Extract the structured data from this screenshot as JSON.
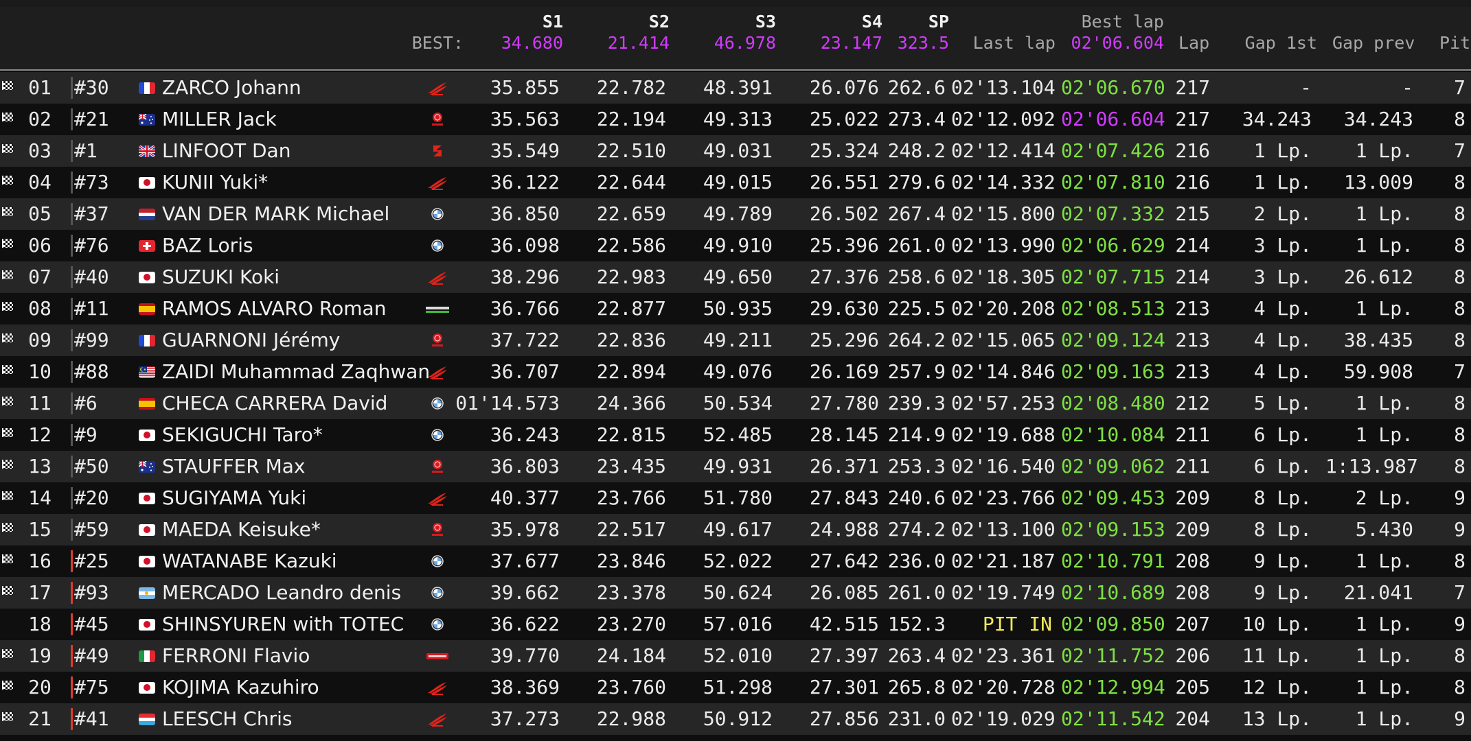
{
  "header": {
    "best_label": "BEST:",
    "s1": {
      "label": "S1",
      "best": "34.680"
    },
    "s2": {
      "label": "S2",
      "best": "21.414"
    },
    "s3": {
      "label": "S3",
      "best": "46.978"
    },
    "s4": {
      "label": "S4",
      "best": "23.147"
    },
    "sp": {
      "label": "SP",
      "best": "323.5"
    },
    "last_lap_label": "Last lap",
    "best_lap": {
      "label": "Best lap",
      "best": "02'06.604"
    },
    "lap_label": "Lap",
    "gap1_label": "Gap 1st",
    "gapprev_label": "Gap prev",
    "pit_label": "Pit"
  },
  "colors": {
    "purple": "#d13bff",
    "green": "#7fe043",
    "yellow": "#f2e85a",
    "red_marker": "#e1392f"
  },
  "rows": [
    {
      "pos": "01",
      "num": "#30",
      "flag": "fr",
      "name": "ZARCO Johann",
      "brand": "honda",
      "s1": "35.855",
      "s2": "22.782",
      "s3": "48.391",
      "s4": "26.076",
      "sp": "262.6",
      "last": "02'13.104",
      "best": "02'06.670",
      "best_color": "green",
      "lap": "217",
      "gap1": "-",
      "gapprev": "-",
      "pit": "7",
      "flagged": true,
      "red": false
    },
    {
      "pos": "02",
      "num": "#21",
      "flag": "au",
      "name": "MILLER Jack",
      "brand": "yamaha",
      "s1": "35.563",
      "s2": "22.194",
      "s3": "49.313",
      "s4": "25.022",
      "sp": "273.4",
      "last": "02'12.092",
      "best": "02'06.604",
      "best_color": "purple",
      "lap": "217",
      "gap1": "34.243",
      "gapprev": "34.243",
      "pit": "8",
      "flagged": true,
      "red": false
    },
    {
      "pos": "03",
      "num": "#1",
      "flag": "gb",
      "name": "LINFOOT Dan",
      "brand": "suzuki",
      "s1": "35.549",
      "s2": "22.510",
      "s3": "49.031",
      "s4": "25.324",
      "sp": "248.2",
      "last": "02'12.414",
      "best": "02'07.426",
      "best_color": "green",
      "lap": "216",
      "gap1": "1 Lp.",
      "gapprev": "1 Lp.",
      "pit": "7",
      "flagged": true,
      "red": false
    },
    {
      "pos": "04",
      "num": "#73",
      "flag": "jp",
      "name": "KUNII Yuki*",
      "brand": "honda",
      "s1": "36.122",
      "s2": "22.644",
      "s3": "49.015",
      "s4": "26.551",
      "sp": "279.6",
      "last": "02'14.332",
      "best": "02'07.810",
      "best_color": "green",
      "lap": "216",
      "gap1": "1 Lp.",
      "gapprev": "13.009",
      "pit": "8",
      "flagged": true,
      "red": false
    },
    {
      "pos": "05",
      "num": "#37",
      "flag": "nl",
      "name": "VAN DER MARK Michael",
      "brand": "bmw",
      "s1": "36.850",
      "s2": "22.659",
      "s3": "49.789",
      "s4": "26.502",
      "sp": "267.4",
      "last": "02'15.800",
      "best": "02'07.332",
      "best_color": "green",
      "lap": "215",
      "gap1": "2 Lp.",
      "gapprev": "1 Lp.",
      "pit": "8",
      "flagged": true,
      "red": false
    },
    {
      "pos": "06",
      "num": "#76",
      "flag": "ch",
      "name": "BAZ Loris",
      "brand": "bmw",
      "s1": "36.098",
      "s2": "22.586",
      "s3": "49.910",
      "s4": "25.396",
      "sp": "261.0",
      "last": "02'13.990",
      "best": "02'06.629",
      "best_color": "green",
      "lap": "214",
      "gap1": "3 Lp.",
      "gapprev": "1 Lp.",
      "pit": "8",
      "flagged": true,
      "red": false
    },
    {
      "pos": "07",
      "num": "#40",
      "flag": "jp",
      "name": "SUZUKI Koki",
      "brand": "honda",
      "s1": "38.296",
      "s2": "22.983",
      "s3": "49.650",
      "s4": "27.376",
      "sp": "258.6",
      "last": "02'18.305",
      "best": "02'07.715",
      "best_color": "green",
      "lap": "214",
      "gap1": "3 Lp.",
      "gapprev": "26.612",
      "pit": "8",
      "flagged": true,
      "red": false
    },
    {
      "pos": "08",
      "num": "#11",
      "flag": "es",
      "name": "RAMOS ALVARO Roman",
      "brand": "kawasaki",
      "s1": "36.766",
      "s2": "22.877",
      "s3": "50.935",
      "s4": "29.630",
      "sp": "225.5",
      "last": "02'20.208",
      "best": "02'08.513",
      "best_color": "green",
      "lap": "213",
      "gap1": "4 Lp.",
      "gapprev": "1 Lp.",
      "pit": "8",
      "flagged": true,
      "red": false
    },
    {
      "pos": "09",
      "num": "#99",
      "flag": "fr",
      "name": "GUARNONI Jérémy",
      "brand": "yamaha",
      "s1": "37.722",
      "s2": "22.836",
      "s3": "49.211",
      "s4": "25.296",
      "sp": "264.2",
      "last": "02'15.065",
      "best": "02'09.124",
      "best_color": "green",
      "lap": "213",
      "gap1": "4 Lp.",
      "gapprev": "38.435",
      "pit": "8",
      "flagged": true,
      "red": false
    },
    {
      "pos": "10",
      "num": "#88",
      "flag": "my",
      "name": "ZAIDI Muhammad Zaqhwan",
      "brand": "honda",
      "s1": "36.707",
      "s2": "22.894",
      "s3": "49.076",
      "s4": "26.169",
      "sp": "257.9",
      "last": "02'14.846",
      "best": "02'09.163",
      "best_color": "green",
      "lap": "213",
      "gap1": "4 Lp.",
      "gapprev": "59.908",
      "pit": "7",
      "flagged": true,
      "red": false
    },
    {
      "pos": "11",
      "num": "#6",
      "flag": "es",
      "name": "CHECA CARRERA David",
      "brand": "bmw",
      "s1": "01'14.573",
      "s2": "24.366",
      "s3": "50.534",
      "s4": "27.780",
      "sp": "239.3",
      "last": "02'57.253",
      "best": "02'08.480",
      "best_color": "green",
      "lap": "212",
      "gap1": "5 Lp.",
      "gapprev": "1 Lp.",
      "pit": "8",
      "flagged": true,
      "red": false
    },
    {
      "pos": "12",
      "num": "#9",
      "flag": "jp",
      "name": "SEKIGUCHI Taro*",
      "brand": "bmw",
      "s1": "36.243",
      "s2": "22.815",
      "s3": "52.485",
      "s4": "28.145",
      "sp": "214.9",
      "last": "02'19.688",
      "best": "02'10.084",
      "best_color": "green",
      "lap": "211",
      "gap1": "6 Lp.",
      "gapprev": "1 Lp.",
      "pit": "8",
      "flagged": true,
      "red": false
    },
    {
      "pos": "13",
      "num": "#50",
      "flag": "au",
      "name": "STAUFFER Max",
      "brand": "yamaha",
      "s1": "36.803",
      "s2": "23.435",
      "s3": "49.931",
      "s4": "26.371",
      "sp": "253.3",
      "last": "02'16.540",
      "best": "02'09.062",
      "best_color": "green",
      "lap": "211",
      "gap1": "6 Lp.",
      "gapprev": "1:13.987",
      "pit": "8",
      "flagged": true,
      "red": false
    },
    {
      "pos": "14",
      "num": "#20",
      "flag": "jp",
      "name": "SUGIYAMA Yuki",
      "brand": "honda",
      "s1": "40.377",
      "s2": "23.766",
      "s3": "51.780",
      "s4": "27.843",
      "sp": "240.6",
      "last": "02'23.766",
      "best": "02'09.453",
      "best_color": "green",
      "lap": "209",
      "gap1": "8 Lp.",
      "gapprev": "2 Lp.",
      "pit": "9",
      "flagged": true,
      "red": false
    },
    {
      "pos": "15",
      "num": "#59",
      "flag": "jp",
      "name": "MAEDA Keisuke*",
      "brand": "yamaha",
      "s1": "35.978",
      "s2": "22.517",
      "s3": "49.617",
      "s4": "24.988",
      "sp": "274.2",
      "last": "02'13.100",
      "best": "02'09.153",
      "best_color": "green",
      "lap": "209",
      "gap1": "8 Lp.",
      "gapprev": "5.430",
      "pit": "9",
      "flagged": true,
      "red": false
    },
    {
      "pos": "16",
      "num": "#25",
      "flag": "jp",
      "name": "WATANABE Kazuki",
      "brand": "bmw",
      "s1": "37.677",
      "s2": "23.846",
      "s3": "52.022",
      "s4": "27.642",
      "sp": "236.0",
      "last": "02'21.187",
      "best": "02'10.791",
      "best_color": "green",
      "lap": "208",
      "gap1": "9 Lp.",
      "gapprev": "1 Lp.",
      "pit": "8",
      "flagged": true,
      "red": true
    },
    {
      "pos": "17",
      "num": "#93",
      "flag": "ar",
      "name": "MERCADO Leandro denis",
      "brand": "bmw",
      "s1": "39.662",
      "s2": "23.378",
      "s3": "50.624",
      "s4": "26.085",
      "sp": "261.0",
      "last": "02'19.749",
      "best": "02'10.689",
      "best_color": "green",
      "lap": "208",
      "gap1": "9 Lp.",
      "gapprev": "21.041",
      "pit": "7",
      "flagged": true,
      "red": true
    },
    {
      "pos": "18",
      "num": "#45",
      "flag": "jp",
      "name": "SHINSYUREN with TOTEC",
      "brand": "bmw",
      "s1": "36.622",
      "s2": "23.270",
      "s3": "57.016",
      "s4": "42.515",
      "sp": "152.3",
      "last": "PIT IN",
      "last_color": "yellow",
      "best": "02'09.850",
      "best_color": "green",
      "lap": "207",
      "gap1": "10 Lp.",
      "gapprev": "1 Lp.",
      "pit": "9",
      "flagged": false,
      "red": true
    },
    {
      "pos": "19",
      "num": "#49",
      "flag": "it",
      "name": "FERRONI Flavio",
      "brand": "aprilia",
      "s1": "39.770",
      "s2": "24.184",
      "s3": "52.010",
      "s4": "27.397",
      "sp": "263.4",
      "last": "02'23.361",
      "best": "02'11.752",
      "best_color": "green",
      "lap": "206",
      "gap1": "11 Lp.",
      "gapprev": "1 Lp.",
      "pit": "8",
      "flagged": true,
      "red": true
    },
    {
      "pos": "20",
      "num": "#75",
      "flag": "jp",
      "name": "KOJIMA Kazuhiro",
      "brand": "honda",
      "s1": "38.369",
      "s2": "23.760",
      "s3": "51.298",
      "s4": "27.301",
      "sp": "265.8",
      "last": "02'20.728",
      "best": "02'12.994",
      "best_color": "green",
      "lap": "205",
      "gap1": "12 Lp.",
      "gapprev": "1 Lp.",
      "pit": "8",
      "flagged": true,
      "red": true
    },
    {
      "pos": "21",
      "num": "#41",
      "flag": "lu",
      "name": "LEESCH Chris",
      "brand": "honda",
      "s1": "37.273",
      "s2": "22.988",
      "s3": "50.912",
      "s4": "27.856",
      "sp": "231.0",
      "last": "02'19.029",
      "best": "02'11.542",
      "best_color": "green",
      "lap": "204",
      "gap1": "13 Lp.",
      "gapprev": "1 Lp.",
      "pit": "9",
      "flagged": true,
      "red": true
    }
  ]
}
